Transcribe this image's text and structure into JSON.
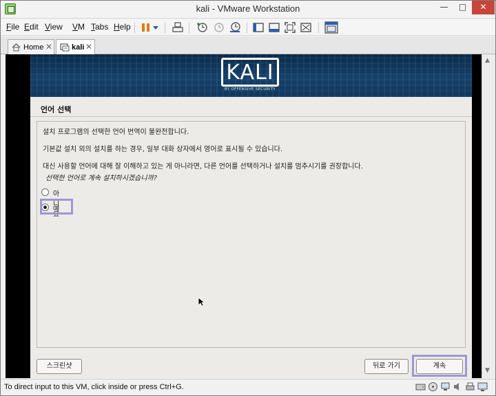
{
  "window": {
    "title": "kali - VMware Workstation",
    "minimize": "—",
    "maximize": "□",
    "close": "✕"
  },
  "menu": {
    "items": [
      {
        "accel": "F",
        "rest": "ile"
      },
      {
        "accel": "E",
        "rest": "dit"
      },
      {
        "accel": "V",
        "rest": "iew"
      },
      {
        "accel": "V",
        "rest": "M"
      },
      {
        "accel": "T",
        "rest": "abs"
      },
      {
        "accel": "H",
        "rest": "elp"
      }
    ]
  },
  "toolbar": {
    "icons": [
      "pause-icon",
      "dropdown-arrow-icon",
      "send-ctrl-alt-del-icon",
      "snapshot-icon",
      "revert-snapshot-icon",
      "snapshot-manager-icon",
      "console-view-icon",
      "unity-icon",
      "full-screen-icon",
      "fit-guest-icon",
      "library-icon"
    ]
  },
  "tabs": [
    {
      "label": "Home",
      "close": "✕",
      "active": false
    },
    {
      "label": "kali",
      "close": "✕",
      "active": true
    }
  ],
  "installer": {
    "logo_text": "KALI",
    "logo_subtext": "BY OFFENSIVE SECURITY",
    "page_title": "언어 선택",
    "lines": [
      "설치 프로그램의 선택한 언어 번역이 불완전합니다.",
      "기본값 설치 외의 설치를 하는 경우, 일부 대화 상자에서 영어로 표시될 수 있습니다.",
      "대신 사용할 언어에 대해 잘 이해하고 있는 게 아니라면, 다른 언어를 선택하거나 설치를 멈추시기를 권장합니다."
    ],
    "question": "선택한 언어로 계속 설치하시겠습니까?",
    "options": [
      {
        "label": "아니요",
        "selected": false
      },
      {
        "label": "예",
        "selected": true
      }
    ],
    "buttons": {
      "screenshot": "스크린샷",
      "back": "뒤로 가기",
      "continue": "계속"
    },
    "highlight_color": "#9c98d8",
    "banner_color": "#14406a"
  },
  "statusbar": {
    "text": "To direct input to this VM, click inside or press Ctrl+G.",
    "icons": [
      "hard-disk-icon",
      "cd-drive-icon",
      "network-icon",
      "sound-icon",
      "printer-icon",
      "display-icon"
    ]
  }
}
